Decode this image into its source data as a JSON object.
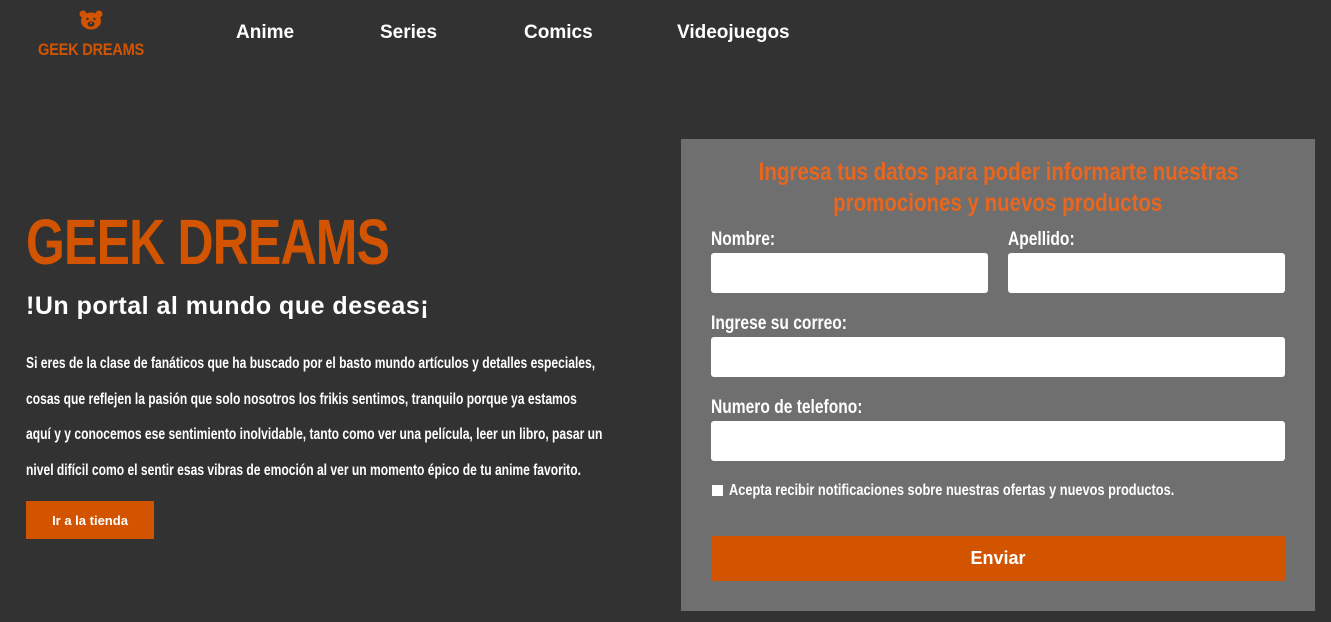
{
  "brand": {
    "logo_text": "GEEK DREAMS",
    "logo_icon": "bear-icon",
    "accent_color": "#d35400"
  },
  "nav": {
    "items": [
      {
        "label": "Anime"
      },
      {
        "label": "Series"
      },
      {
        "label": "Comics"
      },
      {
        "label": "Videojuegos"
      }
    ]
  },
  "hero": {
    "title": "GEEK DREAMS",
    "subtitle": "!Un portal al mundo que deseas¡",
    "description": "Si eres de la clase de fanáticos que ha buscado por el basto mundo artículos y detalles especiales, cosas que reflejen la pasión que solo nosotros los frikis sentimos, tranquilo porque ya estamos aquí y y conocemos ese sentimiento inolvidable, tanto como ver una película, leer un libro, pasar un nivel difícil como el sentir esas vibras de emoción al ver un momento épico de tu anime favorito.",
    "button_label": "Ir a la tienda"
  },
  "form": {
    "heading_line1": "Ingresa tus datos para poder informarte nuestras",
    "heading_line2": "promociones y nuevos productos",
    "fields": {
      "nombre": {
        "label": "Nombre:",
        "value": "",
        "placeholder": ""
      },
      "apellido": {
        "label": "Apellido:",
        "value": "",
        "placeholder": ""
      },
      "correo": {
        "label": "Ingrese su correo:",
        "value": "",
        "placeholder": ""
      },
      "telefono": {
        "label": "Numero de telefono:",
        "value": "",
        "placeholder": ""
      }
    },
    "checkbox_label": "Acepta recibir notificaciones sobre nuestras ofertas y nuevos productos.",
    "checkbox_checked": false,
    "submit_label": "Enviar"
  },
  "colors": {
    "background": "#323232",
    "panel": "#6f6f6f",
    "heading": "#e8661d"
  }
}
